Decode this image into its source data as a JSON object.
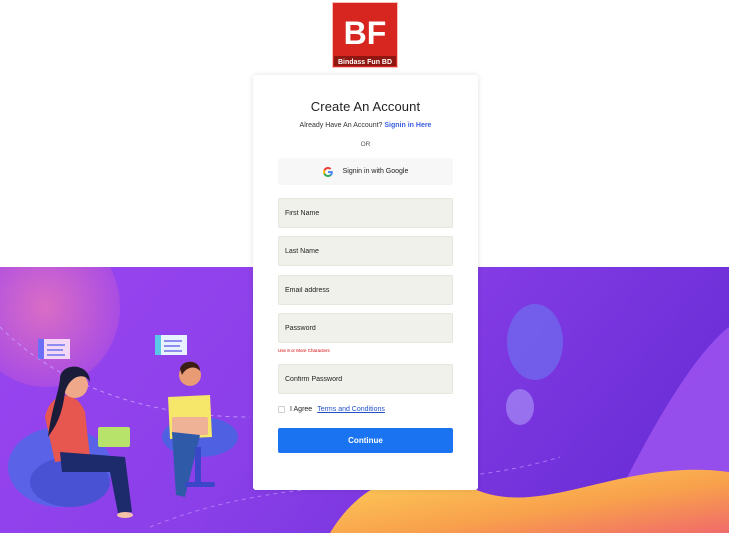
{
  "logo": {
    "letters": "BF",
    "caption": "Bindass Fun BD",
    "bg_color": "#d7261f"
  },
  "signup": {
    "title": "Create An Account",
    "already_text": "Already Have An Account?",
    "signin_link": "Signin in Here",
    "or_text": "OR",
    "google_button": "Signin in with Google",
    "first_name_placeholder": "First Name",
    "last_name_placeholder": "Last Name",
    "email_placeholder": "Email address",
    "password_placeholder": "Password",
    "password_hint": "Use 8 or More Characters",
    "confirm_password_placeholder": "Confirm Password",
    "agree_text": "I Agree",
    "terms_link": "Terms and Conditions",
    "continue_button": "Continue"
  },
  "colors": {
    "primary": "#1a73f0",
    "link": "#3b5ee0",
    "error": "#d40000",
    "background_purple": "#8b3fe6"
  },
  "icons": [
    "google-icon"
  ]
}
